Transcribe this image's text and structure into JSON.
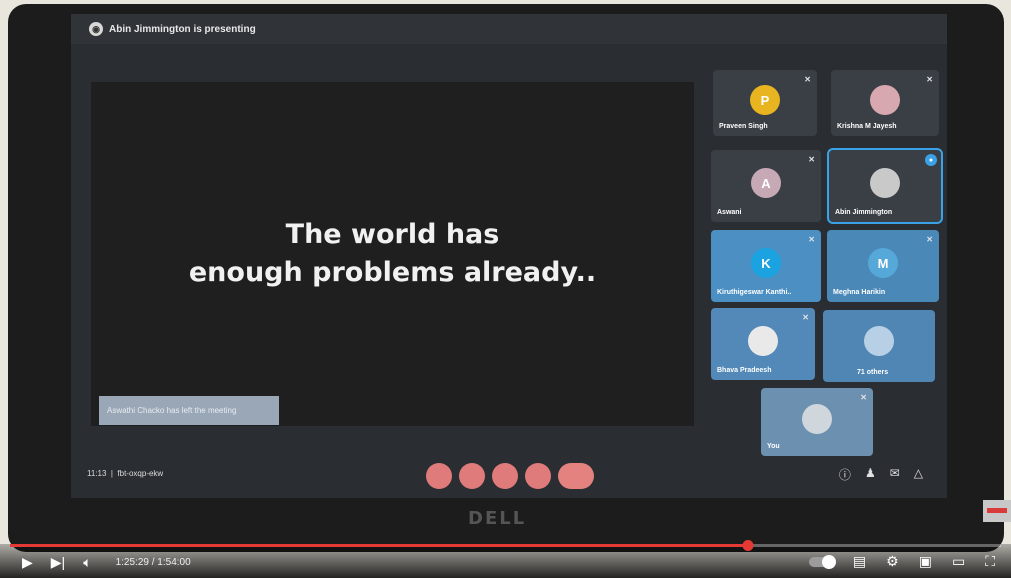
{
  "meet": {
    "presenter_banner": "Abin Jimmington is presenting",
    "slide_text_line1": "The world has",
    "slide_text_line2": "enough problems already..",
    "notification": "Aswathi Chacko has left the meeting",
    "meeting_time": "11:13",
    "meeting_code": "fbt-oxqp-ekw",
    "participants": [
      {
        "name": "Praveen Singh",
        "initial": "P",
        "color": "#e8b41f"
      },
      {
        "name": "Krishna M Jayesh",
        "initial": "",
        "color": "#d8a8b0"
      },
      {
        "name": "Aswani",
        "initial": "A",
        "color": "#c7a8b5"
      },
      {
        "name": "Abin Jimmington",
        "initial": "",
        "color": "#c9c9c9"
      },
      {
        "name": "Kiruthigeswar Kanthi..",
        "initial": "K",
        "color": "#1ba2e0"
      },
      {
        "name": "Meghna Harikin",
        "initial": "M",
        "color": "#56a8d8"
      },
      {
        "name": "Bhava Pradeesh",
        "initial": "",
        "color": "#e9e9e9"
      },
      {
        "name": "71 others",
        "initial": "",
        "color": "#b8d0e6"
      },
      {
        "name": "You",
        "initial": "",
        "color": "#cfd6dc"
      }
    ]
  },
  "monitor": {
    "brand": "DELL"
  },
  "youtube": {
    "time_display": "1:25:29 / 1:54:00",
    "progress_fraction": 0.745,
    "icons": [
      "play-icon",
      "next-icon",
      "volume-icon",
      "autoplay-toggle",
      "subtitles-icon",
      "settings-icon",
      "miniplayer-icon",
      "theater-icon",
      "fullscreen-icon"
    ]
  }
}
